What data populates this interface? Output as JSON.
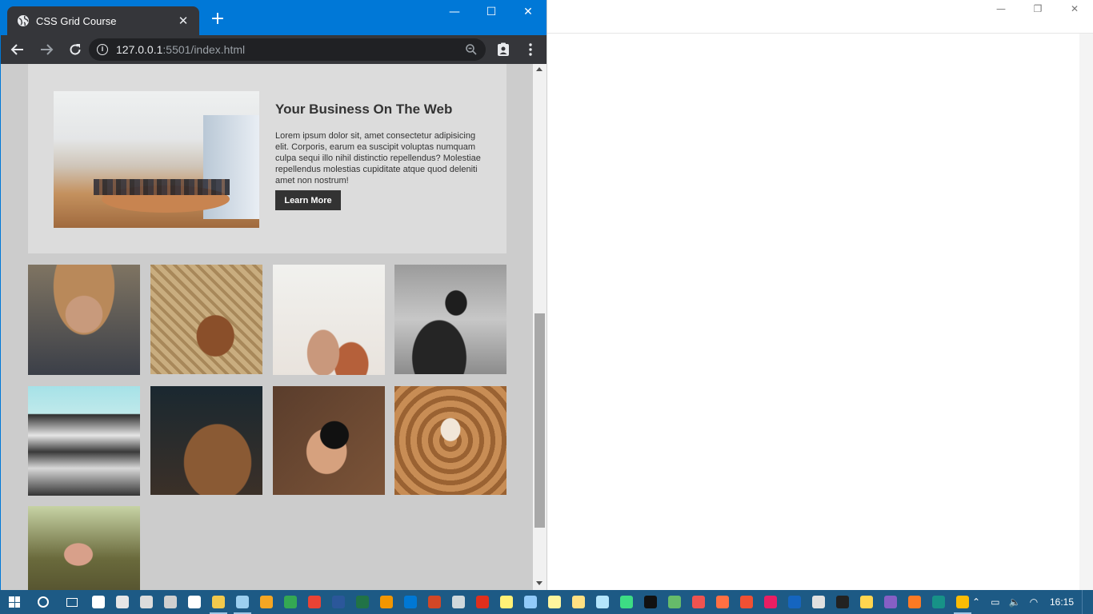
{
  "browser": {
    "tab_title": "CSS Grid Course",
    "tab_close": "✕",
    "new_tab": "+",
    "url_host": "127.0.0.1",
    "url_path": ":5501/index.html",
    "minimize": "—",
    "maximize": "☐",
    "close": "✕",
    "info_glyph": "i"
  },
  "bg_window": {
    "minimize": "—",
    "restore": "❐",
    "close": "✕"
  },
  "showcase": {
    "heading": "Your Business On The Web",
    "body": "Lorem ipsum dolor sit, amet consectetur adipisicing elit. Corporis, earum ea suscipit voluptas numquam culpa sequi illo nihil distinctio repellendus? Molestiae repellendus molestias cupiditate atque quod deleniti amet non nostrum!",
    "button_label": "Learn More"
  },
  "gallery": {
    "images": [
      "man-hat-photo",
      "bread-basket-photo",
      "abstract-hair-photo",
      "phone-hand-photo",
      "japanese-castle-photo",
      "woman-hair-photo",
      "camera-lens-photo",
      "library-stairs-photo",
      "woman-field-photo"
    ]
  },
  "taskbar": {
    "clock": "16:15",
    "apps": [
      {
        "name": "mail",
        "color": "#ffffff"
      },
      {
        "name": "paint",
        "color": "#e6e6e6"
      },
      {
        "name": "network",
        "color": "#dcdcdc"
      },
      {
        "name": "calculator",
        "color": "#cfcfcf"
      },
      {
        "name": "settings",
        "color": "#ffffff"
      },
      {
        "name": "file-explorer",
        "color": "#f2c94c"
      },
      {
        "name": "notepad",
        "color": "#9ccff0"
      },
      {
        "name": "media-player",
        "color": "#f5a623"
      },
      {
        "name": "chrome",
        "color": "#34a853"
      },
      {
        "name": "chrome-canary",
        "color": "#ea4335"
      },
      {
        "name": "word",
        "color": "#2b579a"
      },
      {
        "name": "excel",
        "color": "#217346"
      },
      {
        "name": "sublime",
        "color": "#f29600"
      },
      {
        "name": "vscode",
        "color": "#0078d4"
      },
      {
        "name": "powerpoint",
        "color": "#d24726"
      },
      {
        "name": "photos",
        "color": "#cfd8dc"
      },
      {
        "name": "acrobat",
        "color": "#e02f1d"
      },
      {
        "name": "sticky-notes",
        "color": "#fff176"
      },
      {
        "name": "snipping",
        "color": "#90caf9"
      },
      {
        "name": "notes",
        "color": "#fff59d"
      },
      {
        "name": "tools",
        "color": "#ffe082"
      },
      {
        "name": "network-map",
        "color": "#b3e5fc"
      },
      {
        "name": "android-studio",
        "color": "#3ddc84"
      },
      {
        "name": "intellij",
        "color": "#111111"
      },
      {
        "name": "game",
        "color": "#66bb6a"
      },
      {
        "name": "clock",
        "color": "#ef5350"
      },
      {
        "name": "matlab",
        "color": "#ff7043"
      },
      {
        "name": "git",
        "color": "#f05033"
      },
      {
        "name": "app-pink",
        "color": "#e91e63"
      },
      {
        "name": "blue-app",
        "color": "#1565c0"
      },
      {
        "name": "printer",
        "color": "#e0e0e0"
      },
      {
        "name": "terminal",
        "color": "#222222"
      },
      {
        "name": "python",
        "color": "#ffd54f"
      },
      {
        "name": "visual-studio",
        "color": "#865fc5"
      },
      {
        "name": "xampp",
        "color": "#fb7a24"
      },
      {
        "name": "gitkraken",
        "color": "#179287"
      },
      {
        "name": "chrome-active",
        "color": "#fbbc05"
      }
    ]
  }
}
